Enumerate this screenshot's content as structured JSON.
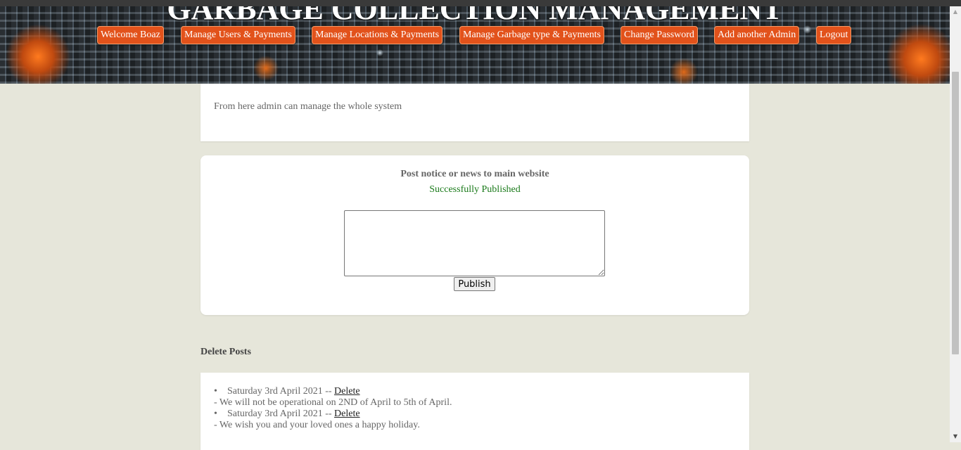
{
  "header": {
    "title": "GARBAGE COLLECTION MANAGEMENT",
    "nav": [
      {
        "label": "Welcome Boaz",
        "name": "nav-welcome-button"
      },
      {
        "label": "Manage Users & Payments",
        "name": "nav-manage-users-button"
      },
      {
        "label": "Manage Locations & Payments",
        "name": "nav-manage-locations-button"
      },
      {
        "label": "Manage Garbage type & Payments",
        "name": "nav-manage-garbage-type-button"
      },
      {
        "label": "Change Password",
        "name": "nav-change-password-button"
      },
      {
        "label": "Add another Admin",
        "name": "nav-add-admin-button"
      },
      {
        "label": "Logout",
        "name": "nav-logout-button"
      }
    ]
  },
  "intro": {
    "text": "From here admin can manage the whole system"
  },
  "notice": {
    "title": "Post notice or news to main website",
    "status": "Successfully Published",
    "textarea_value": "",
    "publish_label": "Publish"
  },
  "delete_posts": {
    "heading": "Delete Posts",
    "posts": [
      {
        "date": "Saturday 3rd April 2021 --",
        "delete_label": "Delete",
        "text": "- We will not be operational on 2ND of April to 5th of April."
      },
      {
        "date": "Saturday 3rd April 2021 --",
        "delete_label": "Delete",
        "text": "- We wish you and your loved ones a happy holiday."
      }
    ]
  },
  "colors": {
    "page_bg": "#e6e6da",
    "nav_button": "#e2521b",
    "success": "#1a7a1a"
  }
}
